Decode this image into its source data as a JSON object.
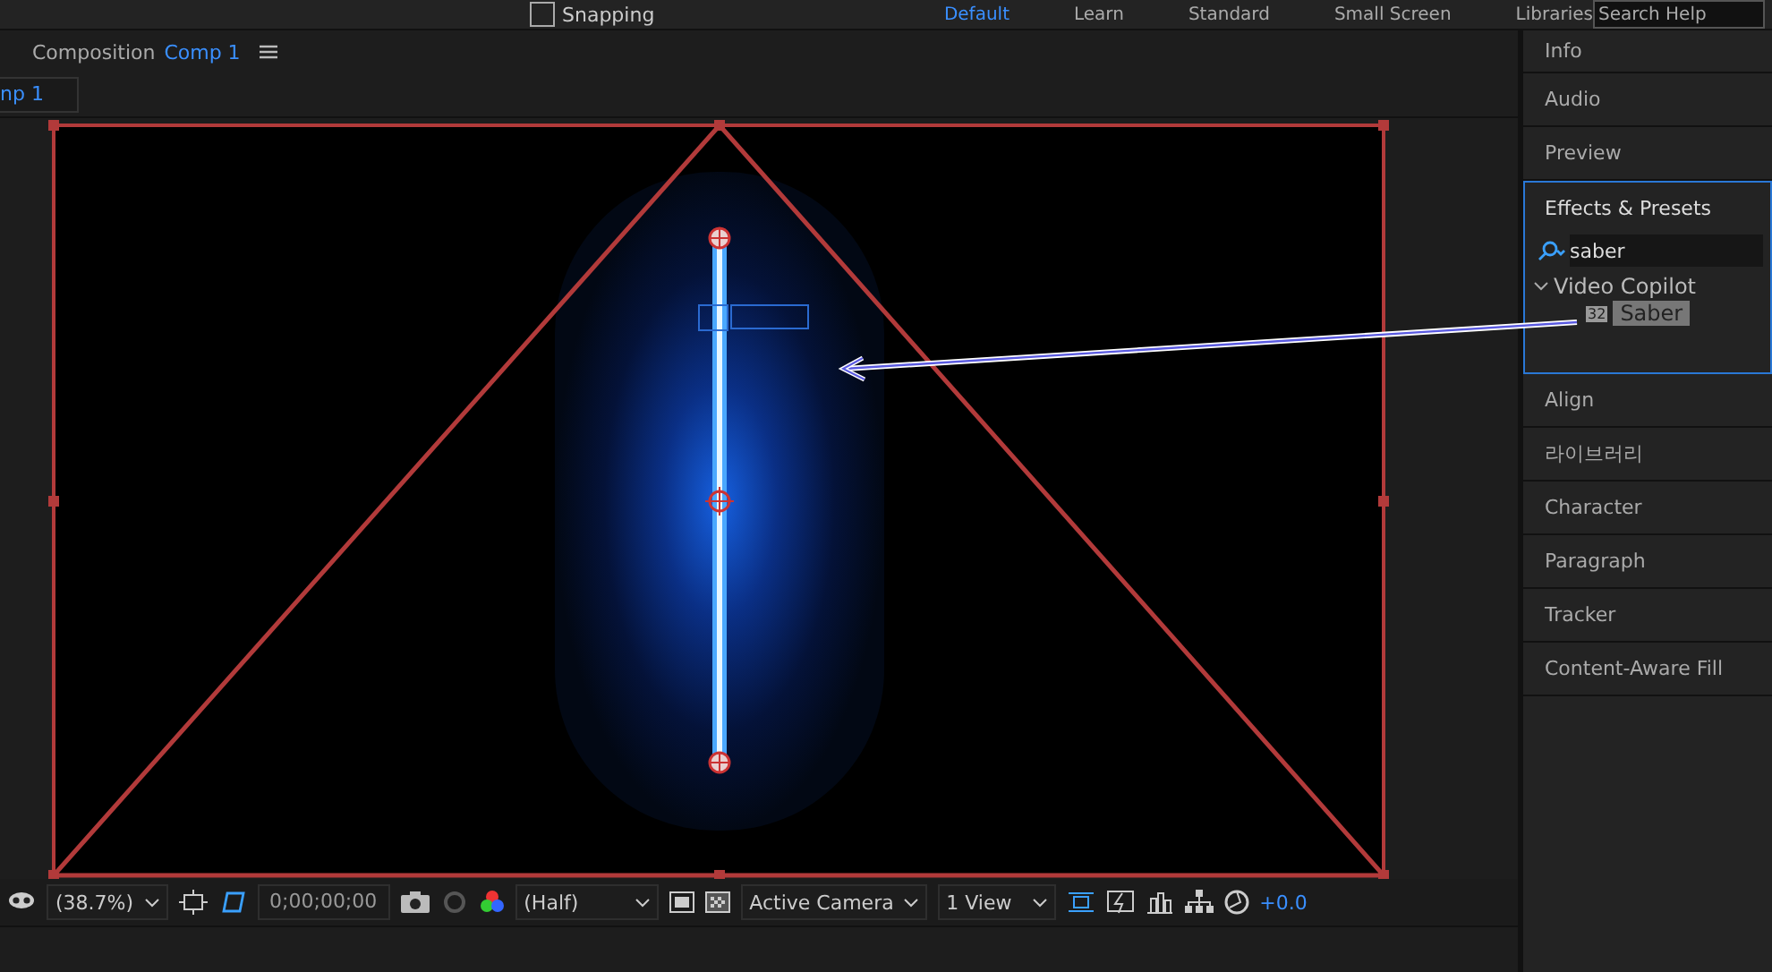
{
  "top_bar": {
    "snapping": {
      "label": "Snapping",
      "checked": false
    },
    "workspaces": [
      {
        "label": "Default",
        "selected": true
      },
      {
        "label": "Learn",
        "selected": false
      },
      {
        "label": "Standard",
        "selected": false
      },
      {
        "label": "Small Screen",
        "selected": false
      },
      {
        "label": "Libraries",
        "selected": false
      }
    ],
    "search": {
      "placeholder": "Search Help"
    }
  },
  "composition_panel": {
    "title": "Composition",
    "comp_name": "Comp 1",
    "tab": {
      "label": "np 1",
      "selected": true
    }
  },
  "viewer_toolbar": {
    "zoom": "(38.7%)",
    "timecode": "0;00;00;00",
    "resolution": "(Half)",
    "camera": "Active Camera",
    "views": "1 View",
    "exposure": "+0.0"
  },
  "right_panels": [
    {
      "label": "Info",
      "expanded": false
    },
    {
      "label": "Audio",
      "expanded": false
    },
    {
      "label": "Preview",
      "expanded": false
    },
    {
      "label": "Effects & Presets",
      "expanded": true,
      "search": {
        "value": "saber"
      },
      "tree": [
        {
          "label": "Video Copilot",
          "expanded": true,
          "children": [
            {
              "label": "Saber",
              "badge": "32",
              "selected": true
            }
          ]
        }
      ]
    },
    {
      "label": "Align",
      "expanded": false
    },
    {
      "label": "라이브러리",
      "expanded": false
    },
    {
      "label": "Character",
      "expanded": false
    },
    {
      "label": "Paragraph",
      "expanded": false
    },
    {
      "label": "Tracker",
      "expanded": false
    },
    {
      "label": "Content-Aware Fill",
      "expanded": false
    }
  ]
}
